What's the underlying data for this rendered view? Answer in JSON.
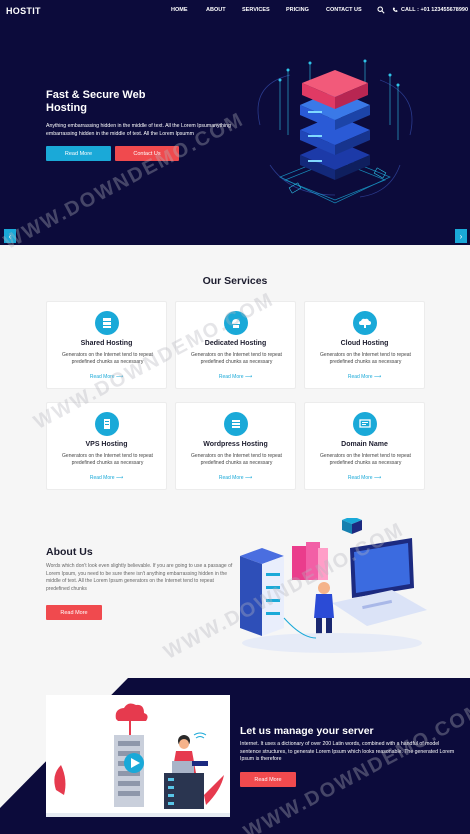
{
  "nav": {
    "brand": "HOSTIT",
    "links": [
      "HOME",
      "ABOUT",
      "SERVICES",
      "PRICING",
      "CONTACT US"
    ],
    "call": "CALL : +01 123455678990"
  },
  "hero": {
    "title": "Fast & Secure Web Hosting",
    "text": "Anything embarrassing hidden in the middle of text. All the Lorem Ipsumanything embarrassing hidden in the middle of text. All the Lorem Ipsumm",
    "read_more": "Read More",
    "contact_us": "Contact Us"
  },
  "services": {
    "title": "Our Services",
    "cards": [
      {
        "title": "Shared Hosting",
        "text": "Generators on the Internet tend to repeat predefined chunks as necessary",
        "link": "Read More ⟶"
      },
      {
        "title": "Dedicated Hosting",
        "text": "Generators on the Internet tend to repeat predefined chunks as necessary",
        "link": "Read More ⟶"
      },
      {
        "title": "Cloud Hosting",
        "text": "Generators on the Internet tend to repeat predefined chunks as necessary",
        "link": "Read More ⟶"
      },
      {
        "title": "VPS Hosting",
        "text": "Generators on the Internet tend to repeat predefined chunks as necessary",
        "link": "Read More ⟶"
      },
      {
        "title": "Wordpress Hosting",
        "text": "Generators on the Internet tend to repeat predefined chunks as necessary",
        "link": "Read More ⟶"
      },
      {
        "title": "Domain Name",
        "text": "Generators on the Internet tend to repeat predefined chunks as necessary",
        "link": "Read More ⟶"
      }
    ]
  },
  "about": {
    "title": "About Us",
    "text": "Words which don't look even slightly believable. If you are going to use a passage of Lorem Ipsum, you need to be sure there isn't anything embarrassing hidden in the middle of text. All the Lorem Ipsum generators on the Internet tend to repeat predefined chunks",
    "read_more": "Read More"
  },
  "manage": {
    "title": "Let us manage your server",
    "text": "Internet. It uses a dictionary of over 200 Latin words, combined with a handful of model sentence structures, to generate Lorem Ipsum which looks reasonable. The generated Lorem Ipsum is therefore",
    "read_more": "Read More"
  },
  "watermark": "WWW.DOWNDEMO.COM",
  "colors": {
    "navy": "#0c0b3b",
    "accent_blue": "#1aa9d8",
    "accent_red": "#f04a4e",
    "section_bg": "#f6f6f6"
  }
}
